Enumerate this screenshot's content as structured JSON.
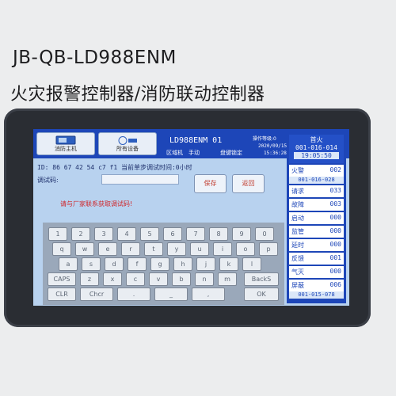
{
  "model": "JB-QB-LD988ENM",
  "product_name": "火灾报警控制器/消防联动控制器",
  "topbar": {
    "tab1_label": "消防主机",
    "tab2_label": "所有设备",
    "title": "LD988ENM 01",
    "mode1": "区域机",
    "mode2": "手动",
    "mode3": "盘键锁定",
    "op_level": "操作等级:0",
    "date": "2020/09/15",
    "time": "15:36:28"
  },
  "status_panel": {
    "first_fire_label": "首火",
    "first_fire_address": "001-016-014",
    "first_fire_time": "19:05:50",
    "items": [
      {
        "label": "火警",
        "count": "002",
        "sub": "001-016-028"
      },
      {
        "label": "请求",
        "count": "033"
      },
      {
        "label": "故障",
        "count": "003"
      },
      {
        "label": "启动",
        "count": "000"
      },
      {
        "label": "监管",
        "count": "000"
      },
      {
        "label": "延时",
        "count": "000"
      },
      {
        "label": "反馈",
        "count": "001"
      },
      {
        "label": "气灭",
        "count": "000"
      },
      {
        "label": "屏蔽",
        "count": "006",
        "sub": "001-015-078"
      }
    ]
  },
  "main": {
    "id_line": "ID: 86 67 42 54 c7 f1 当前单步调试时间:0小时",
    "password_label": "调试码:",
    "password_value": "",
    "save_label": "保存",
    "exit_label": "返回",
    "note": "请与厂家联系获取调试码!"
  },
  "keyboard": {
    "row1": [
      "1",
      "2",
      "3",
      "4",
      "5",
      "6",
      "7",
      "8",
      "9",
      "0"
    ],
    "row2": [
      "q",
      "w",
      "e",
      "r",
      "t",
      "y",
      "u",
      "i",
      "o",
      "p"
    ],
    "row3": [
      "a",
      "s",
      "d",
      "f",
      "g",
      "h",
      "j",
      "k",
      "l"
    ],
    "row4": [
      "CAPS",
      "z",
      "x",
      "c",
      "v",
      "b",
      "n",
      "m",
      "BackS"
    ],
    "row5": [
      "CLR",
      "Chcr",
      ".",
      "_",
      ",",
      "OK"
    ]
  }
}
